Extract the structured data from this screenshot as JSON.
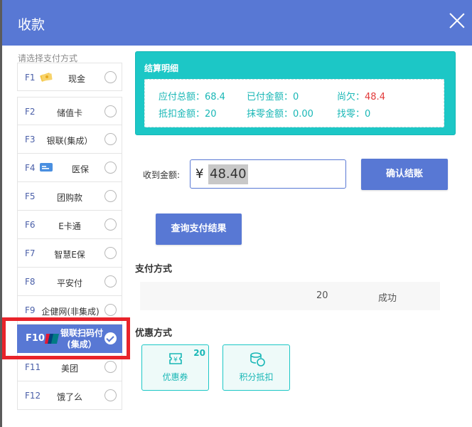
{
  "dialog": {
    "title": "收款"
  },
  "payment_methods": {
    "hint": "请选择支付方式",
    "items": [
      {
        "key": "F1",
        "label": "现金",
        "icon": "cash-icon"
      },
      {
        "key": "F2",
        "label": "储值卡"
      },
      {
        "key": "F3",
        "label": "银联(集成）"
      },
      {
        "key": "F4",
        "label": "医保",
        "icon": "insurance-card-icon"
      },
      {
        "key": "F5",
        "label": "团购款"
      },
      {
        "key": "F6",
        "label": "E卡通"
      },
      {
        "key": "F7",
        "label": "智慧E保"
      },
      {
        "key": "F8",
        "label": "平安付"
      },
      {
        "key": "F9",
        "label": "企健网(非集成)"
      },
      {
        "key": "F10",
        "label": "银联扫码付(集成）",
        "icon": "unionpay-icon",
        "selected": true
      },
      {
        "key": "F11",
        "label": "美团"
      },
      {
        "key": "F12",
        "label": "饿了么"
      }
    ]
  },
  "summary": {
    "title": "结算明细",
    "total_due": "应付总额：68.4",
    "paid": "已付金额：0",
    "owed_label": "尚欠：",
    "owed_value": "48.4",
    "deduction": "抵扣金额：20",
    "rounding": "抹零金额：0.00",
    "change": "找零：0"
  },
  "receive": {
    "label": "收到金额:",
    "currency": "¥",
    "amount": "48.40",
    "confirm_label": "确认结账",
    "query_label": "查询支付结果"
  },
  "payment_section": {
    "title": "支付方式",
    "rows": [
      {
        "amount": "20",
        "status": "成功"
      }
    ]
  },
  "promo_section": {
    "title": "优惠方式",
    "items": [
      {
        "label": "优惠券",
        "badge": "20",
        "icon": "coupon-icon"
      },
      {
        "label": "积分抵扣",
        "icon": "points-coins-icon"
      }
    ]
  },
  "colors": {
    "primary": "#5878d4",
    "teal": "#1cc7c6",
    "highlight": "#e8232a"
  }
}
